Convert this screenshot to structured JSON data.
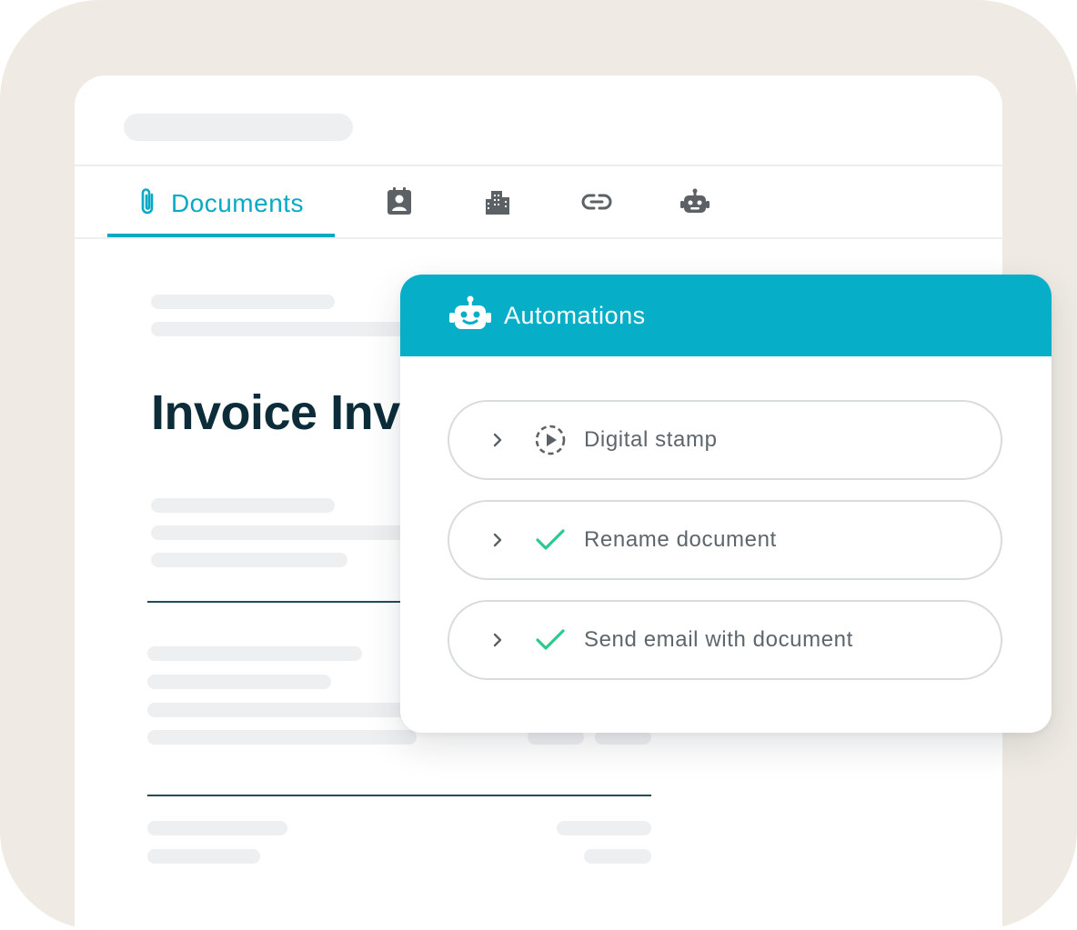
{
  "tabs": {
    "documents_label": "Documents",
    "icons": [
      "attachment-icon",
      "contact-card-icon",
      "building-icon",
      "link-icon",
      "robot-icon"
    ]
  },
  "document": {
    "title": "Invoice Inv"
  },
  "automations": {
    "title": "Automations",
    "items": [
      {
        "label": "Digital stamp",
        "status": "pending"
      },
      {
        "label": "Rename document",
        "status": "done"
      },
      {
        "label": "Send email with document",
        "status": "done"
      }
    ]
  },
  "colors": {
    "accent": "#07aec8",
    "success": "#2ec98f",
    "title_text": "#0c2c3a",
    "background": "#efebe4"
  }
}
